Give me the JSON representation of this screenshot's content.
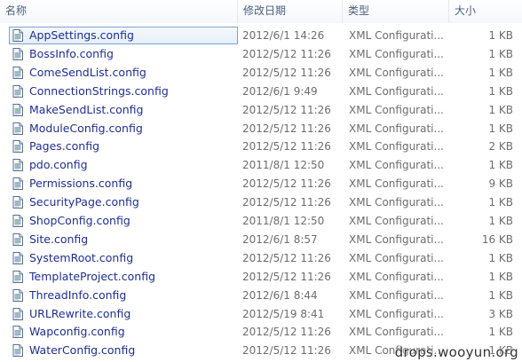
{
  "columns": {
    "name": "名称",
    "date": "修改日期",
    "type": "类型",
    "size": "大小"
  },
  "files": [
    {
      "name": "AppSettings.config",
      "date": "2012/6/1 14:26",
      "type": "XML Configurati...",
      "size": "1 KB",
      "selected": true
    },
    {
      "name": "BossInfo.config",
      "date": "2012/5/12 11:26",
      "type": "XML Configurati...",
      "size": "1 KB"
    },
    {
      "name": "ComeSendList.config",
      "date": "2012/5/12 11:26",
      "type": "XML Configurati...",
      "size": "1 KB"
    },
    {
      "name": "ConnectionStrings.config",
      "date": "2012/6/1 9:49",
      "type": "XML Configurati...",
      "size": "1 KB"
    },
    {
      "name": "MakeSendList.config",
      "date": "2012/5/12 11:26",
      "type": "XML Configurati...",
      "size": "1 KB"
    },
    {
      "name": "ModuleConfig.config",
      "date": "2012/5/12 11:26",
      "type": "XML Configurati...",
      "size": "1 KB"
    },
    {
      "name": "Pages.config",
      "date": "2012/5/12 11:26",
      "type": "XML Configurati...",
      "size": "2 KB"
    },
    {
      "name": "pdo.config",
      "date": "2011/8/1 12:50",
      "type": "XML Configurati...",
      "size": "1 KB"
    },
    {
      "name": "Permissions.config",
      "date": "2012/5/12 11:26",
      "type": "XML Configurati...",
      "size": "9 KB"
    },
    {
      "name": "SecurityPage.config",
      "date": "2012/5/12 11:26",
      "type": "XML Configurati...",
      "size": "1 KB"
    },
    {
      "name": "ShopConfig.config",
      "date": "2011/8/1 12:50",
      "type": "XML Configurati...",
      "size": "1 KB"
    },
    {
      "name": "Site.config",
      "date": "2012/6/1 8:57",
      "type": "XML Configurati...",
      "size": "16 KB"
    },
    {
      "name": "SystemRoot.config",
      "date": "2012/5/12 11:26",
      "type": "XML Configurati...",
      "size": "1 KB"
    },
    {
      "name": "TemplateProject.config",
      "date": "2012/5/12 11:26",
      "type": "XML Configurati...",
      "size": "1 KB"
    },
    {
      "name": "ThreadInfo.config",
      "date": "2012/6/1 8:44",
      "type": "XML Configurati...",
      "size": "1 KB"
    },
    {
      "name": "URLRewrite.config",
      "date": "2012/5/19 8:41",
      "type": "XML Configurati...",
      "size": "3 KB"
    },
    {
      "name": "Wapconfig.config",
      "date": "2012/5/12 11:26",
      "type": "XML Configurati...",
      "size": "1 KB"
    },
    {
      "name": "WaterConfig.config",
      "date": "2012/5/12 11:26",
      "type": "XML Configurati...",
      "size": "1 KB"
    }
  ],
  "icons": {
    "file": "xml-config-file-icon"
  },
  "colors": {
    "file_name": "#1f2f8f",
    "detail_text": "#6d6d6d",
    "header_text": "#4c607a",
    "selection_border": "#7da2ce"
  },
  "watermark": "drops.wooyun.org"
}
